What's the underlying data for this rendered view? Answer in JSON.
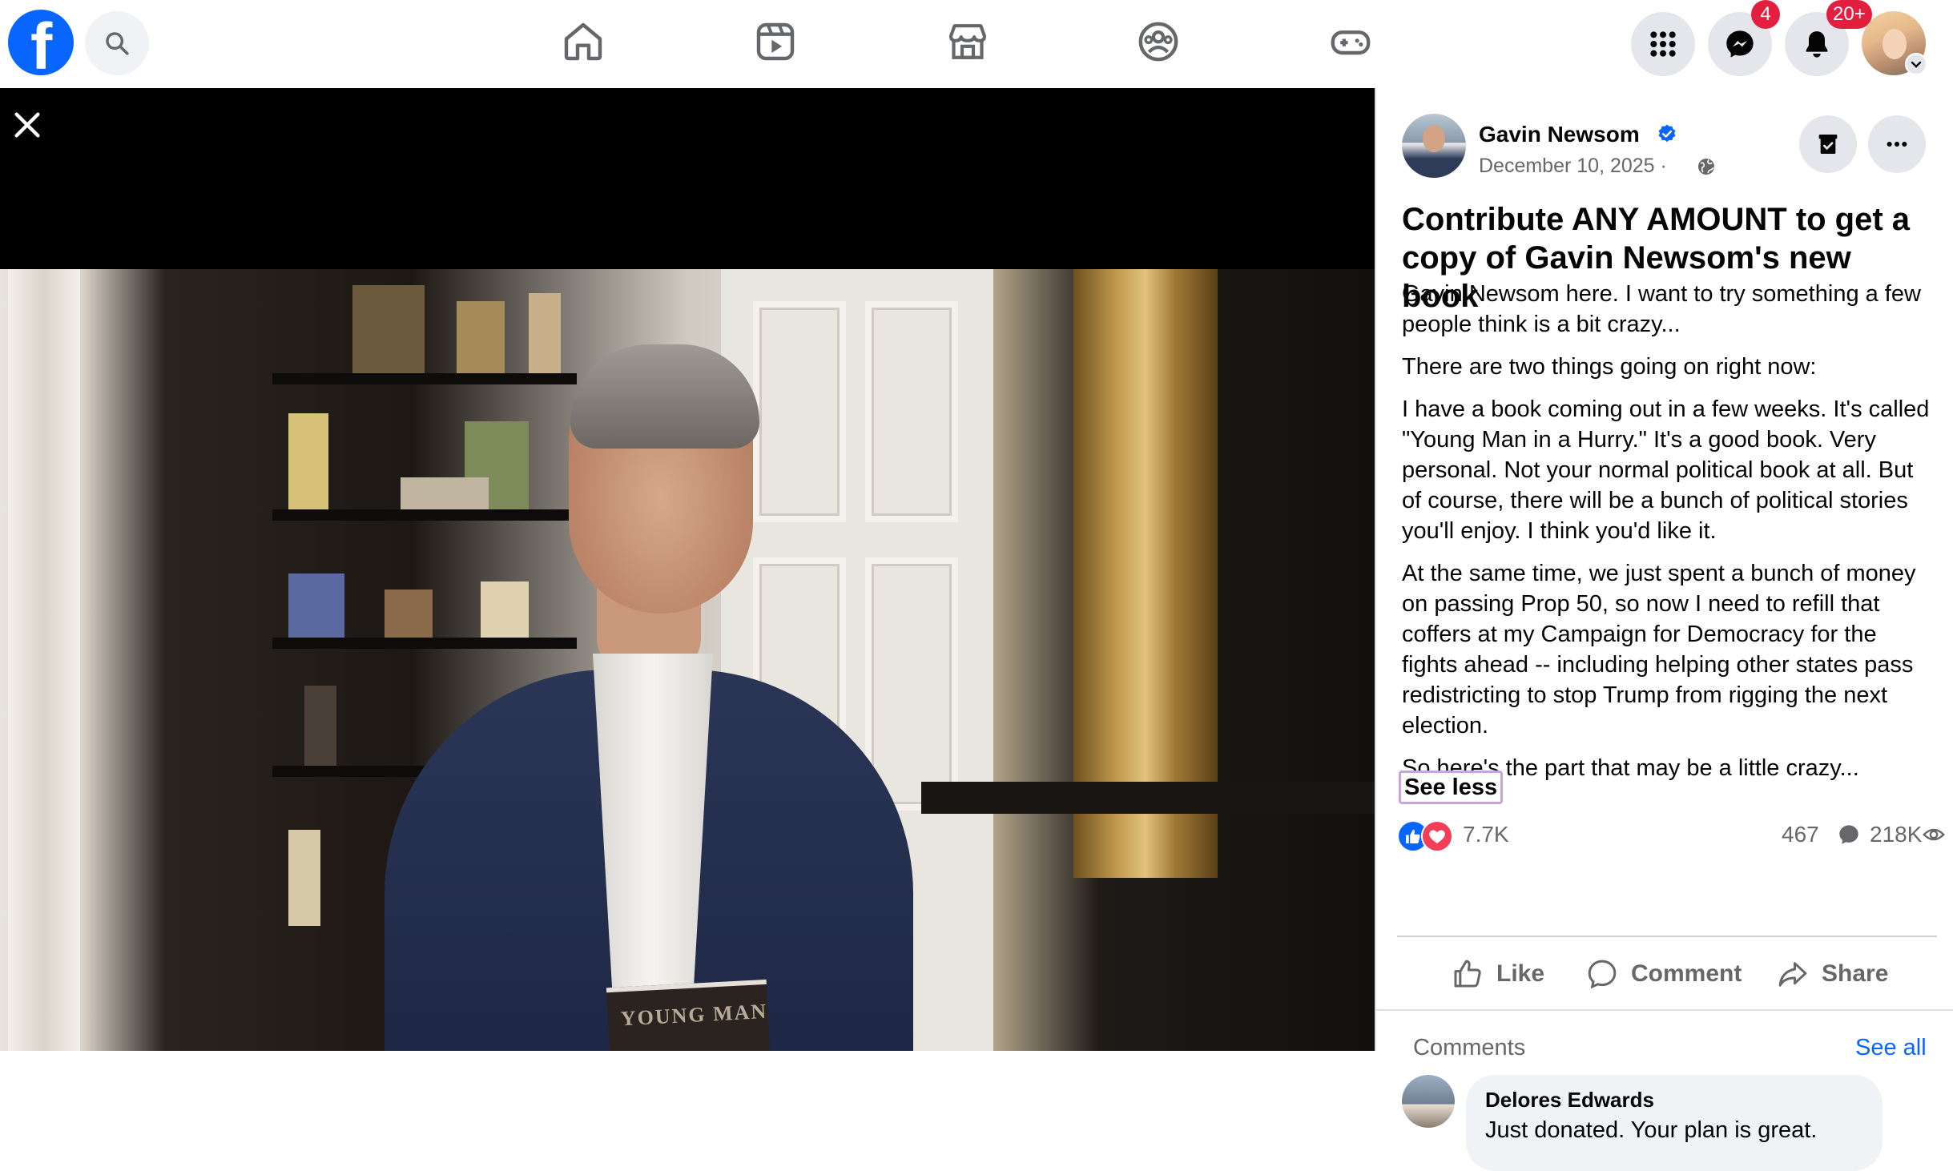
{
  "topbar": {
    "messenger_badge": "4",
    "notifications_badge": "20+"
  },
  "post": {
    "author": "Gavin Newsom",
    "date": "December 10, 2025",
    "separator": "·",
    "title": "Contribute ANY AMOUNT to get a copy of Gavin Newsom's new book",
    "paragraphs": [
      "Gavin Newsom here. I want to try something a few people think is a bit crazy...",
      "There are two things going on right now:",
      "I have a book coming out in a few weeks. It's called \"Young Man in a Hurry.\" It's a good book. Very personal. Not your normal political book at all. But of course, there will be a bunch of political stories you'll enjoy. I think you'd like it.",
      "At the same time, we just spent a bunch of money on passing Prop 50, so now I need to refill that coffers at my Campaign for Democracy for the fights ahead -- including helping other states pass redistricting to stop Trump from rigging the next election.",
      "So here's the part that may be a little crazy..."
    ],
    "see_less": "See less",
    "reactions_count": "7.7K",
    "comments_count": "467",
    "views_count": "218K",
    "actions": {
      "like": "Like",
      "comment": "Comment",
      "share": "Share"
    }
  },
  "video": {
    "book_cover_text": "YOUNG MAN"
  },
  "comments": {
    "label": "Comments",
    "see_all": "See all",
    "items": [
      {
        "author": "Delores Edwards",
        "text": "Just donated. Your plan is great."
      }
    ]
  },
  "icons": {
    "logo": "facebook-logo",
    "search": "search-icon",
    "home": "home-icon",
    "video": "video-icon",
    "marketplace": "marketplace-icon",
    "groups": "groups-icon",
    "gaming": "gaming-icon",
    "menu": "grid-menu-icon",
    "messenger": "messenger-icon",
    "notifications": "bell-icon",
    "close": "close-icon",
    "verified": "verified-badge-icon",
    "audience": "globe-icon",
    "save": "save-icon",
    "more": "more-icon"
  },
  "colors": {
    "brand": "#0866ff",
    "badge": "#e41e3f",
    "secondary_text": "#65676b",
    "love": "#f33e58"
  }
}
